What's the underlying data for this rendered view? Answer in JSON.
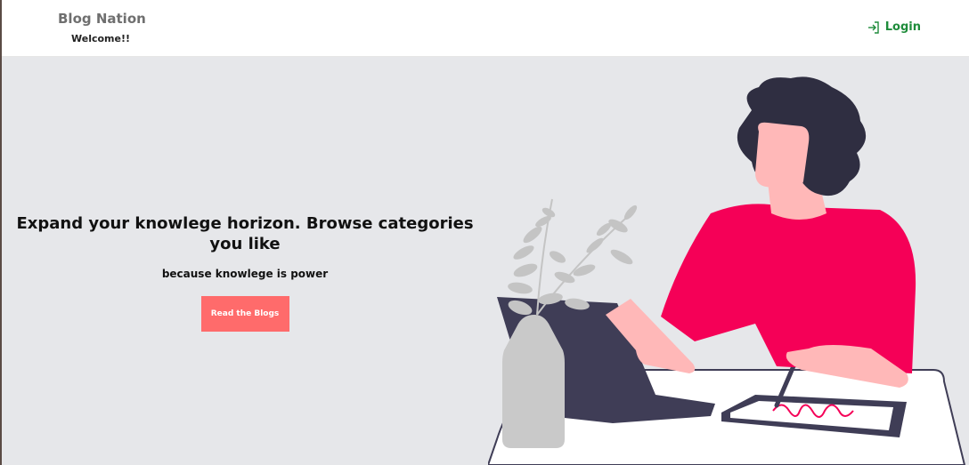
{
  "nav": {
    "brand": "Blog Nation",
    "welcome": "Welcome!!",
    "login_label": "Login",
    "login_icon": "login-icon"
  },
  "hero": {
    "headline": "Expand your knowlege horizon. Browse categories you like",
    "subline": "because knowlege is power",
    "cta_label": "Read the Blogs",
    "illustration": "person-writing-on-tablet-illustration"
  },
  "colors": {
    "hero_bg": "#e6e7ea",
    "cta_bg": "#ff6b6b",
    "login": "#1f8c3b",
    "shirt": "#f50057",
    "hair": "#2f2e41",
    "laptop": "#3f3d56",
    "skin": "#ffb8b8",
    "vase": "#c9c9c9"
  }
}
